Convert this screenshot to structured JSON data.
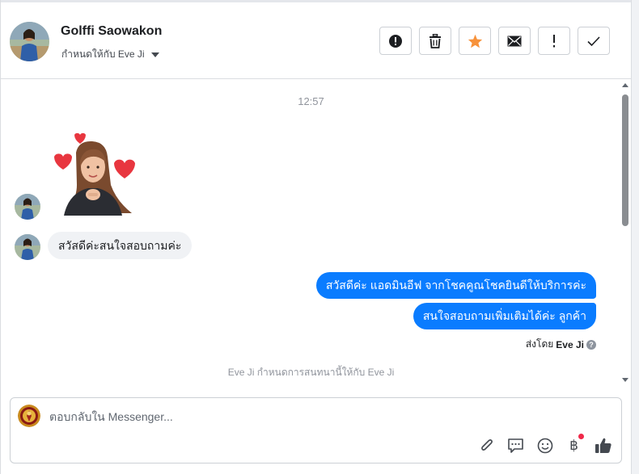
{
  "header": {
    "contact_name": "Golffi Saowakon",
    "assigned_label": "กำหนดให้กับ Eve Ji",
    "actions": [
      {
        "name": "spam-button",
        "icon": "alert-circle-icon"
      },
      {
        "name": "delete-button",
        "icon": "trash-icon"
      },
      {
        "name": "star-button",
        "icon": "star-icon"
      },
      {
        "name": "mark-unread-button",
        "icon": "envelope-icon"
      },
      {
        "name": "follow-up-button",
        "icon": "exclamation-icon"
      },
      {
        "name": "mark-done-button",
        "icon": "checkmark-icon"
      }
    ]
  },
  "conversation": {
    "timestamp": "12:57",
    "incoming_message": "สวัสดีค่ะสนใจสอบถามค่ะ",
    "outgoing_messages": [
      "สวัสดีค่ะ แอดมินอีฟ จากโชคคูณโชคยินดีให้บริการค่ะ",
      "สนใจสอบถามเพิ่มเติมได้ค่ะ ลูกค้า"
    ],
    "sent_by_prefix": "ส่งโดย",
    "sent_by_name": "Eve Ji",
    "system_note": "Eve Ji กำหนดการสนทนานี้ให้กับ Eve Ji"
  },
  "composer": {
    "placeholder": "ตอบกลับใน Messenger...",
    "tools": [
      "paperclip-icon",
      "speech-bubble-icon",
      "emoji-icon",
      "baht-icon",
      "thumbs-up-icon"
    ],
    "baht_symbol": "฿"
  },
  "colors": {
    "accent_blue": "#0a7cff",
    "star_orange": "#f7923b",
    "incoming_bubble": "#f0f2f5",
    "notification_red": "#f02849"
  }
}
